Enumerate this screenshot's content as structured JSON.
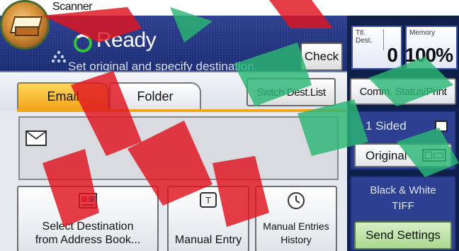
{
  "title_bar": {
    "app_title": "Scanner"
  },
  "status": {
    "state": "Ready",
    "message": "Set original and specify destination.",
    "check_label": "Check"
  },
  "counters": {
    "ttl_dest_label": "Ttl. Dest.",
    "ttl_dest_value": "0",
    "memory_label": "Memory",
    "memory_value": "100%"
  },
  "tabs": [
    {
      "label": "Email",
      "selected": true
    },
    {
      "label": "Folder",
      "selected": false
    }
  ],
  "switch_dest_label": "Swtch Dest.List",
  "destination_field": {
    "icon": "envelope-icon",
    "value": ""
  },
  "buttons": {
    "address_book": [
      "Select Destination",
      "from Address Book..."
    ],
    "manual_entry": "Manual Entry",
    "manual_history": [
      "Manual Entries",
      "History"
    ]
  },
  "right_panel": {
    "comm_status": "Comm. Status/Print",
    "sides": "1 Sided",
    "original": "Original",
    "color_mode": "Black & White",
    "file_type": "TIFF",
    "send_settings": "Send Settings"
  },
  "colors": {
    "accent_tab": "#f2a61c",
    "status_band": "#2d3f8f",
    "send_settings": "#a9d88e",
    "ready_indicator": "#34c23d"
  }
}
